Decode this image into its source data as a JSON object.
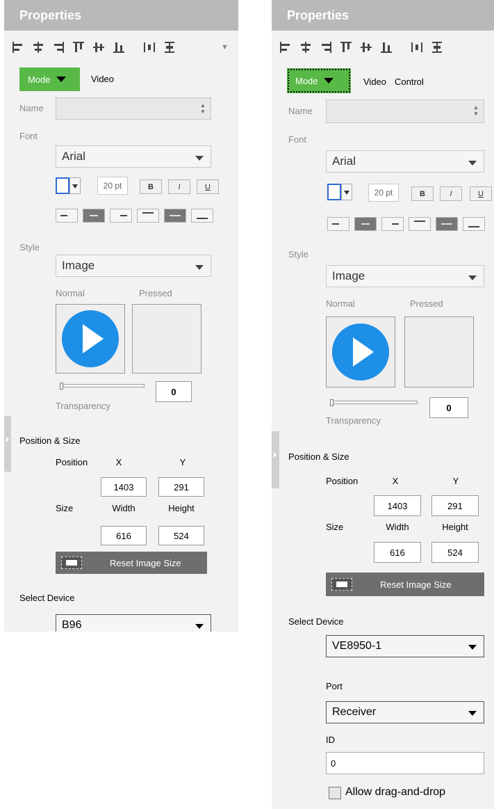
{
  "panels": [
    {
      "header_title": "Properties",
      "toolbar": {
        "icons": [
          "align-left-icon",
          "align-center-icon",
          "align-right-icon",
          "align-top-icon",
          "align-middle-icon",
          "align-bottom-icon",
          "distribute-horizontal-icon",
          "distribute-vertical-icon"
        ],
        "overflow": "▼"
      },
      "mode_label": "Mode",
      "tabs": [
        "Video"
      ],
      "name_label": "Name",
      "name_value": "",
      "font_label": "Font",
      "font_value": "Arial",
      "font_size": "20 pt",
      "bold_label": "B",
      "italic_label": "I",
      "underline_label": "U",
      "style_label": "Style",
      "style_value": "Image",
      "normal_label": "Normal",
      "pressed_label": "Pressed",
      "transparency_value": "0",
      "transparency_label": "Transparency",
      "position_size_label": "Position & Size",
      "position_label": "Position",
      "x_label": "X",
      "y_label": "Y",
      "x_value": "1403",
      "y_value": "291",
      "size_label": "Size",
      "width_label": "Width",
      "height_label": "Height",
      "width_value": "616",
      "height_value": "524",
      "reset_label": "Reset Image Size",
      "select_device_label": "Select Device",
      "device_value": "B96"
    },
    {
      "header_title": "Properties",
      "toolbar": {
        "icons": [
          "align-left-icon",
          "align-center-icon",
          "align-right-icon",
          "align-top-icon",
          "align-middle-icon",
          "align-bottom-icon",
          "distribute-horizontal-icon",
          "distribute-vertical-icon"
        ]
      },
      "mode_label": "Mode",
      "tabs": [
        "Video",
        "Control"
      ],
      "name_label": "Name",
      "name_value": "",
      "font_label": "Font",
      "font_value": "Arial",
      "font_size": "20 pt",
      "bold_label": "B",
      "italic_label": "I",
      "underline_label": "U",
      "style_label": "Style",
      "style_value": "Image",
      "normal_label": "Normal",
      "pressed_label": "Pressed",
      "transparency_value": "0",
      "transparency_label": "Transparency",
      "position_size_label": "Position & Size",
      "position_label": "Position",
      "x_label": "X",
      "y_label": "Y",
      "x_value": "1403",
      "y_value": "291",
      "size_label": "Size",
      "width_label": "Width",
      "height_label": "Height",
      "width_value": "616",
      "height_value": "524",
      "reset_label": "Reset Image Size",
      "select_device_label": "Select Device",
      "device_value": "VE8950-1",
      "port_label": "Port",
      "port_value": "Receiver",
      "id_label": "ID",
      "id_value": "0",
      "allow_drag_label": "Allow drag-and-drop"
    }
  ],
  "colors": {
    "header_bg": "#b9b9b9",
    "panel_bg": "#f2f2f2",
    "mode_green": "#58b947",
    "play_blue": "#1e8fe6",
    "reset_btn": "#6e6e6e"
  }
}
